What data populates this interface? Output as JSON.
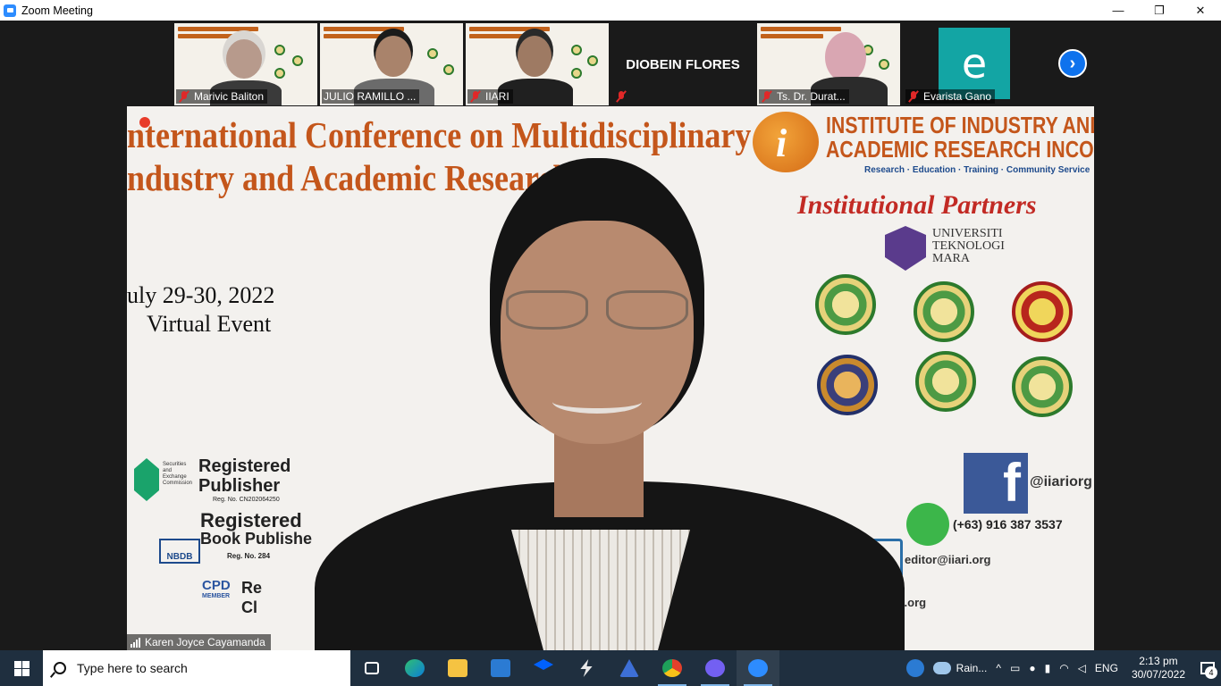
{
  "window": {
    "title": "Zoom Meeting",
    "controls": {
      "minimize": "—",
      "restore": "❐",
      "close": "✕"
    }
  },
  "gallery": {
    "tiles": [
      {
        "name": "Marivic Baliton",
        "muted": true,
        "type": "video"
      },
      {
        "name": "JULIO RAMILLO ...",
        "muted": false,
        "type": "video"
      },
      {
        "name": "IIARI",
        "muted": true,
        "type": "video"
      },
      {
        "name": "DIOBEIN FLORES",
        "muted": true,
        "type": "name-only"
      },
      {
        "name": "Ts. Dr. Durat...",
        "muted": true,
        "type": "video"
      },
      {
        "name": "Evarista Gano",
        "muted": true,
        "type": "avatar",
        "avatar_letter": "e",
        "avatar_color": "#13a5a4"
      }
    ],
    "next_arrow": "›"
  },
  "main_video": {
    "speaker_name": "Karen Joyce Cayamanda",
    "slide": {
      "title_line1": "nternational Conference on Multidisciplinary",
      "title_line2": "ndustry and Academic Research",
      "date_line1": "uly 29-30, 2022",
      "date_line2": "Virtual Event",
      "org_name_line1": "INSTITUTE OF INDUSTRY AND",
      "org_name_line2": "ACADEMIC RESEARCH INCORPORATED",
      "org_tagline": "Research · Education · Training · Community Service",
      "partners_heading": "Institutional Partners",
      "uitm_line1": "UNIVERSITI",
      "uitm_line2": "TEKNOLOGI",
      "uitm_line3": "MARA",
      "fb_handle": "@iiariorg",
      "phone": "(+63) 916 387 3537",
      "email": "editor@iiari.org",
      "website": "iari.org",
      "reg1_line1": "Registered",
      "reg1_line2": "Publisher",
      "reg1_no": "Reg. No. CN202064250",
      "sec_small": "Securities and Exchange Commission",
      "reg2_line1": "Registered",
      "reg2_line2": "Book Publishe",
      "reg2_no": "Reg. No. 284",
      "nbdb": "NBDB",
      "cpd": "CPD",
      "cpd_sub": "MEMBER",
      "reg3_fragment": "Re",
      "reg3_fragment2": "Cl"
    }
  },
  "taskbar": {
    "search_placeholder": "Type here to search",
    "apps": [
      "task-view",
      "edge",
      "file-explorer",
      "mail",
      "dropbox",
      "app-lightning",
      "app-a",
      "chrome",
      "viber",
      "zoom"
    ],
    "weather_text": "Rain...",
    "language": "ENG",
    "time": "2:13 pm",
    "date": "30/07/2022",
    "notifications_count": "4"
  },
  "colors": {
    "zoom_blue": "#0e72ed",
    "taskbar_bg": "#1f2f3f",
    "stage_bg": "#1a1a1a",
    "mute_red": "#e02828",
    "slide_orange": "#c4561b"
  }
}
